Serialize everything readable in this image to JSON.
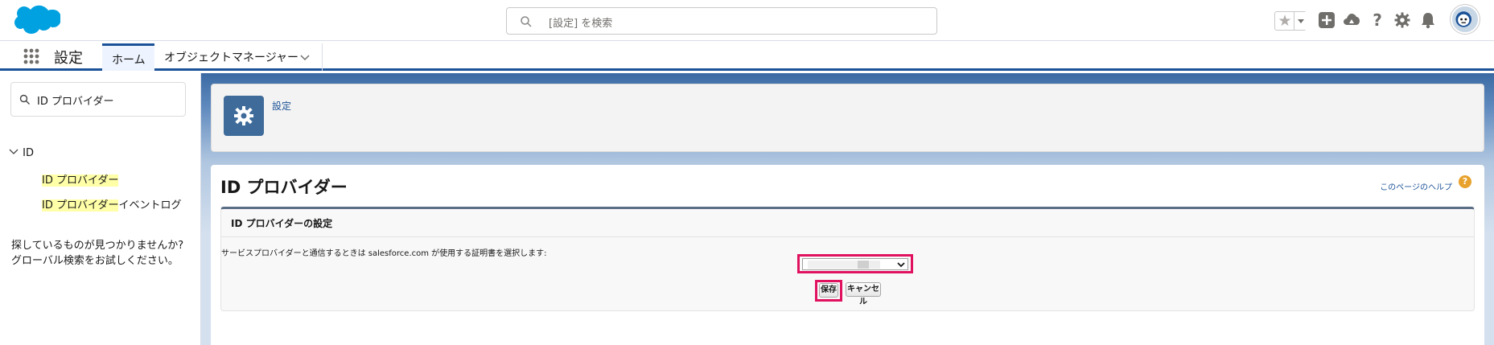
{
  "header": {
    "search_placeholder": "[設定] を検索"
  },
  "context_bar": {
    "app_name": "設定",
    "tabs": [
      {
        "label": "ホーム"
      },
      {
        "label": "オブジェクトマネージャー"
      }
    ]
  },
  "sidebar": {
    "quick_find_value": "ID プロバイダー",
    "tree_root": "ID",
    "items": [
      {
        "highlight": "ID プロバイダー",
        "rest": ""
      },
      {
        "highlight": "ID プロバイダー",
        "rest": "イベントログ"
      }
    ],
    "not_found_line1": "探しているものが見つかりませんか?",
    "not_found_line2": "グローバル検索をお試しください。"
  },
  "setup_header": {
    "breadcrumb": "設定"
  },
  "page": {
    "title": "ID プロバイダー",
    "help_link": "このページのヘルプ",
    "help_icon_glyph": "?",
    "block_title": "ID プロバイダーの設定",
    "cert_label": "サービスプロバイダーと通信するときは salesforce.com が使用する証明書を選択します:",
    "save_button": "保存",
    "cancel_button": "キャンセル"
  },
  "colors": {
    "brand_blue": "#1b5297",
    "highlight_border": "#e0115f",
    "search_highlight": "#ffffa8",
    "setup_icon_bg": "#3e6b9a"
  },
  "icons": [
    "salesforce-cloud-logo",
    "search-icon",
    "favorite-star-icon",
    "add-icon",
    "trailhead-icon",
    "help-icon",
    "gear-icon",
    "notification-bell-icon",
    "user-avatar",
    "app-launcher-icon",
    "chevron-down-icon"
  ]
}
